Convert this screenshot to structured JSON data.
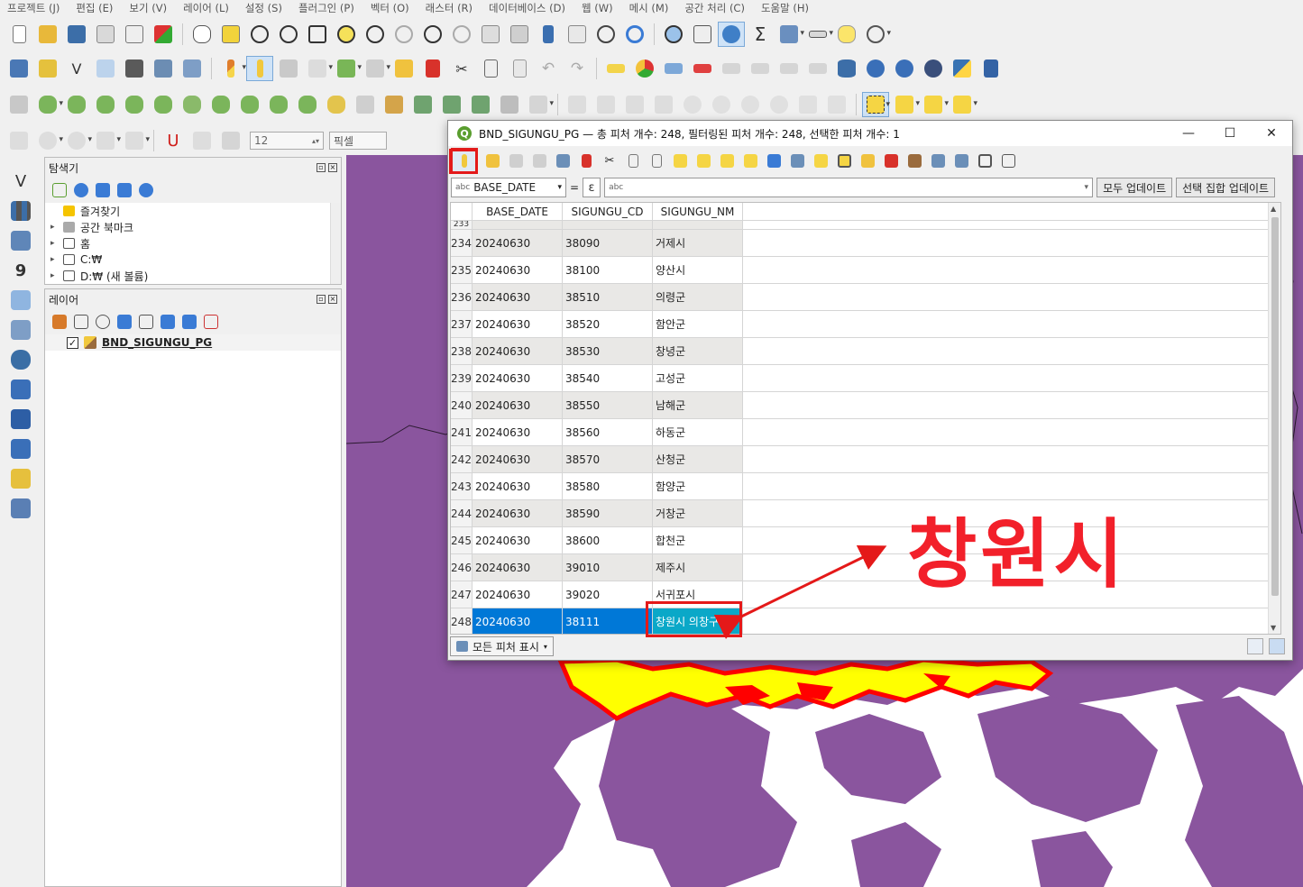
{
  "menubar": [
    "프로젝트 (J)",
    "편집 (E)",
    "보기 (V)",
    "레이어 (L)",
    "설정 (S)",
    "플러그인 (P)",
    "벡터 (O)",
    "래스터 (R)",
    "데이터베이스 (D)",
    "웹 (W)",
    "메시 (M)",
    "공간 처리 (C)",
    "도움말 (H)"
  ],
  "snapping": {
    "tolerance": "12",
    "unit": "픽셀"
  },
  "browser_panel": {
    "title": "탐색기",
    "items": [
      {
        "label": "즐겨찾기",
        "icon": "star-icon"
      },
      {
        "label": "공간 북마크",
        "icon": "bookmark-icon"
      },
      {
        "label": "홈",
        "icon": "home-folder-icon"
      },
      {
        "label": "C:₩",
        "icon": "folder-icon"
      },
      {
        "label": "D:₩ (새 볼륨)",
        "icon": "folder-icon"
      }
    ]
  },
  "layers_panel": {
    "title": "레이어",
    "layers": [
      {
        "label": "BND_SIGUNGU_PG",
        "checked": true
      }
    ]
  },
  "attribute_window": {
    "title": "BND_SIGUNGU_PG — 총 피처 개수: 248, 필터링된 피처 개수: 248, 선택한 피처 개수: 1",
    "field_select": "BASE_DATE",
    "field_type": "abc",
    "equals": "=",
    "epsilon": "ε",
    "value_placeholder": "abc",
    "update_all": "모두 업데이트",
    "update_selected": "선택 집합 업데이트",
    "columns": [
      "BASE_DATE",
      "SIGUNGU_CD",
      "SIGUNGU_NM"
    ],
    "partial_row": {
      "id": "233"
    },
    "rows": [
      {
        "id": "234",
        "base_date": "20240630",
        "code": "38090",
        "name": "거제시"
      },
      {
        "id": "235",
        "base_date": "20240630",
        "code": "38100",
        "name": "양산시"
      },
      {
        "id": "236",
        "base_date": "20240630",
        "code": "38510",
        "name": "의령군"
      },
      {
        "id": "237",
        "base_date": "20240630",
        "code": "38520",
        "name": "함안군"
      },
      {
        "id": "238",
        "base_date": "20240630",
        "code": "38530",
        "name": "창녕군"
      },
      {
        "id": "239",
        "base_date": "20240630",
        "code": "38540",
        "name": "고성군"
      },
      {
        "id": "240",
        "base_date": "20240630",
        "code": "38550",
        "name": "남해군"
      },
      {
        "id": "241",
        "base_date": "20240630",
        "code": "38560",
        "name": "하동군"
      },
      {
        "id": "242",
        "base_date": "20240630",
        "code": "38570",
        "name": "산청군"
      },
      {
        "id": "243",
        "base_date": "20240630",
        "code": "38580",
        "name": "함양군"
      },
      {
        "id": "244",
        "base_date": "20240630",
        "code": "38590",
        "name": "거창군"
      },
      {
        "id": "245",
        "base_date": "20240630",
        "code": "38600",
        "name": "합천군"
      },
      {
        "id": "246",
        "base_date": "20240630",
        "code": "39010",
        "name": "제주시"
      },
      {
        "id": "247",
        "base_date": "20240630",
        "code": "39020",
        "name": "서귀포시"
      },
      {
        "id": "248",
        "base_date": "20240630",
        "code": "38111",
        "name": "창원시 의창구",
        "selected": true
      }
    ],
    "show_all": "모든 피처 표시"
  },
  "annotation": {
    "text": "창원시",
    "color": "#f2202a"
  },
  "colors": {
    "map_fill": "#8a559e",
    "selection": "#ffff00",
    "selection_outline": "#ff0000",
    "row_selected": "#0078d7"
  }
}
